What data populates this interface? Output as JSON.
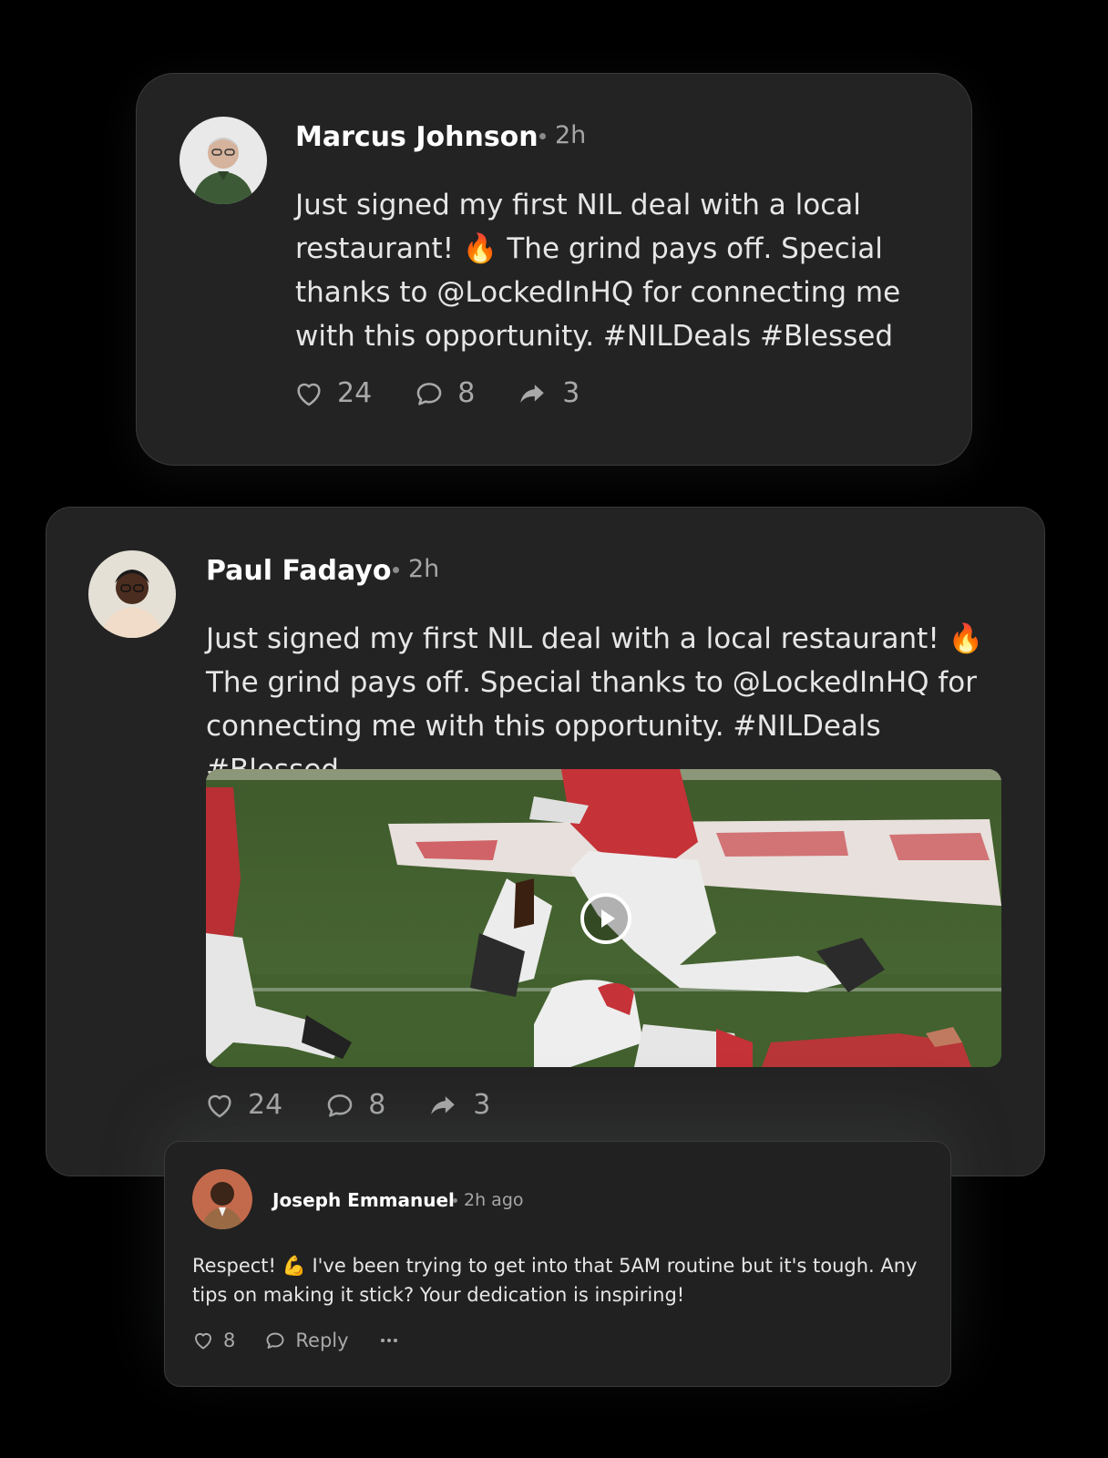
{
  "posts": [
    {
      "author": "Marcus Johnson",
      "time": "2h",
      "text": "Just signed my first NIL deal with a local restaurant! 🔥 The grind pays off. Special thanks to @LockedInHQ for connecting me with this opportunity. #NILDeals #Blessed",
      "likes": "24",
      "comments": "8",
      "shares": "3"
    },
    {
      "author": "Paul Fadayo",
      "time": "2h",
      "text": "Just signed my first NIL deal with a local restaurant! 🔥 The grind pays off. Special thanks to @LockedInHQ for connecting me with this opportunity. #NILDeals #Blessed",
      "likes": "24",
      "comments": "8",
      "shares": "3",
      "media": {
        "type": "video",
        "description_icon": "play-icon"
      }
    }
  ],
  "comment": {
    "author": "Joseph Emmanuel",
    "time": "2h ago",
    "text": "Respect! 💪 I've been trying to get into that 5AM routine but it's tough. Any tips on making it stick? Your dedication is inspiring!",
    "likes": "8",
    "reply_label": "Reply"
  },
  "icons": {
    "like": "heart-icon",
    "comment": "comment-bubble-icon",
    "share": "share-arrow-icon",
    "more": "more-dots-icon",
    "play": "play-icon"
  },
  "colors": {
    "background": "#000000",
    "card": "#232323",
    "border": "#3a3a3a",
    "text_primary": "#ffffff",
    "text_muted": "#a6a6a6"
  }
}
